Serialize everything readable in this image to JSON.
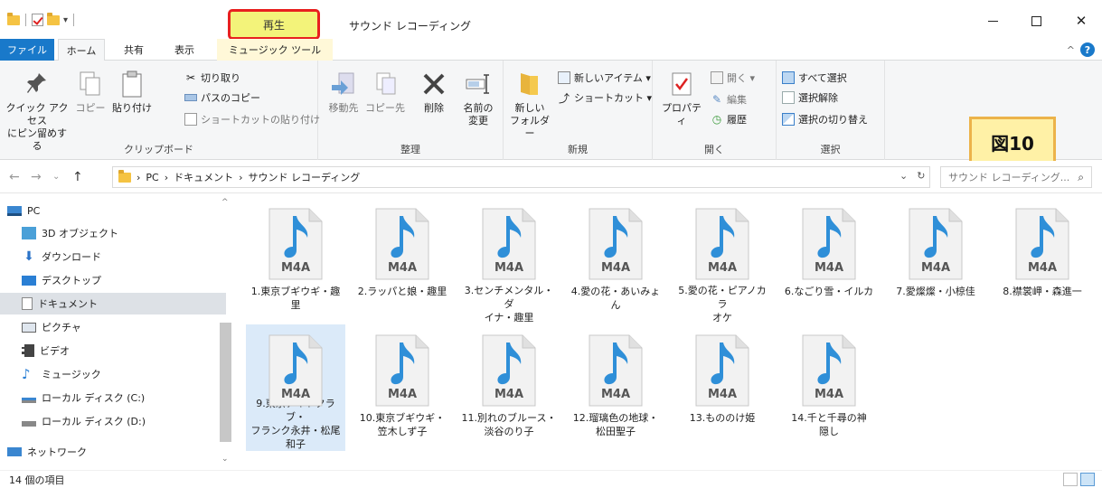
{
  "titlebar": {
    "contextual_tab": "再生",
    "window_title": "サウンド レコーディング",
    "minimize": "–",
    "close": "✕"
  },
  "tabs": {
    "file": "ファイル",
    "home": "ホーム",
    "share": "共有",
    "view": "表示",
    "music_tools": "ミュージック ツール",
    "collapse": "^",
    "help": "?"
  },
  "ribbon": {
    "clipboard": {
      "label": "クリップボード",
      "pin_quick_access": "クイック アクセス\nにピン留めする",
      "copy": "コピー",
      "paste": "貼り付け",
      "cut": "切り取り",
      "copy_path": "パスのコピー",
      "paste_shortcut": "ショートカットの貼り付け"
    },
    "organize": {
      "label": "整理",
      "move_to": "移動先",
      "copy_to": "コピー先",
      "delete": "削除",
      "rename": "名前の\n変更"
    },
    "new": {
      "label": "新規",
      "new_folder": "新しい\nフォルダー",
      "new_item": "新しいアイテム ▾",
      "shortcut": "ショートカット ▾"
    },
    "open": {
      "label": "開く",
      "properties": "プロパティ",
      "open": "開く ▾",
      "edit": "編集",
      "history": "履歴"
    },
    "select": {
      "label": "選択",
      "select_all": "すべて選択",
      "select_none": "選択解除",
      "invert_selection": "選択の切り替え"
    }
  },
  "figure_label": "図10",
  "address": {
    "path": [
      "PC",
      "ドキュメント",
      "サウンド レコーディング"
    ],
    "separator": "›",
    "search_placeholder": "サウンド レコーディング..."
  },
  "navpane": {
    "items": [
      {
        "label": "PC",
        "icon": "pc-icon"
      },
      {
        "label": "3D オブジェクト",
        "icon": "3d-objects-icon"
      },
      {
        "label": "ダウンロード",
        "icon": "download-icon"
      },
      {
        "label": "デスクトップ",
        "icon": "desktop-icon"
      },
      {
        "label": "ドキュメント",
        "icon": "documents-icon",
        "selected": true
      },
      {
        "label": "ピクチャ",
        "icon": "pictures-icon"
      },
      {
        "label": "ビデオ",
        "icon": "videos-icon"
      },
      {
        "label": "ミュージック",
        "icon": "music-icon"
      },
      {
        "label": "ローカル ディスク (C:)",
        "icon": "disk-c-icon"
      },
      {
        "label": "ローカル ディスク (D:)",
        "icon": "disk-d-icon"
      },
      {
        "label": "ネットワーク",
        "icon": "network-icon"
      }
    ]
  },
  "file_type_label": "M4A",
  "files": [
    {
      "name": "1.東京ブギウギ・趣\n里"
    },
    {
      "name": "2.ラッパと娘・趣里"
    },
    {
      "name": "3.センチメンタル・ダ\nイナ・趣里"
    },
    {
      "name": "4.愛の花・あいみょ\nん"
    },
    {
      "name": "5.愛の花・ピアノカラ\nオケ"
    },
    {
      "name": "6.なごり雪・イルカ"
    },
    {
      "name": "7.愛燦燦・小椋佳"
    },
    {
      "name": "8.襟裳岬・森進一"
    },
    {
      "name": "9.東京ナイトクラブ・\nフランク永井・松尾\n和子",
      "selected": true
    },
    {
      "name": "10.東京ブギウギ・\n笠木しず子"
    },
    {
      "name": "11.別れのブルース・\n淡谷のり子"
    },
    {
      "name": "12.瑠璃色の地球・\n松田聖子"
    },
    {
      "name": "13.もののけ姫"
    },
    {
      "name": "14.千と千尋の神\n隠し"
    }
  ],
  "status": {
    "item_count": "14 個の項目"
  },
  "colors": {
    "accent_blue": "#1979ca",
    "music_note": "#2f8fd8",
    "highlight_yellow": "#f3f37a",
    "highlight_red_border": "#e8201f"
  }
}
